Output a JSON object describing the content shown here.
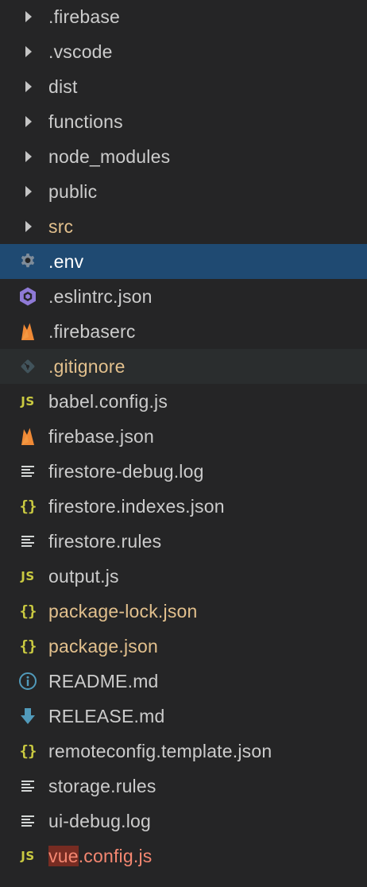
{
  "explorer": {
    "items": [
      {
        "name": ".firebase",
        "kind": "folder",
        "icon": "chevron-right-icon"
      },
      {
        "name": ".vscode",
        "kind": "folder",
        "icon": "chevron-right-icon"
      },
      {
        "name": "dist",
        "kind": "folder",
        "icon": "chevron-right-icon"
      },
      {
        "name": "functions",
        "kind": "folder",
        "icon": "chevron-right-icon"
      },
      {
        "name": "node_modules",
        "kind": "folder",
        "icon": "chevron-right-icon"
      },
      {
        "name": "public",
        "kind": "folder",
        "icon": "chevron-right-icon"
      },
      {
        "name": "src",
        "kind": "folder",
        "icon": "chevron-right-icon",
        "status": "modified"
      },
      {
        "name": ".env",
        "kind": "file",
        "icon": "gear-icon",
        "state": "selected"
      },
      {
        "name": ".eslintrc.json",
        "kind": "file",
        "icon": "eslint-icon"
      },
      {
        "name": ".firebaserc",
        "kind": "file",
        "icon": "firebase-icon"
      },
      {
        "name": ".gitignore",
        "kind": "file",
        "icon": "git-icon",
        "status": "modified",
        "state": "hover"
      },
      {
        "name": "babel.config.js",
        "kind": "file",
        "icon": "javascript-icon",
        "glyph": "JS"
      },
      {
        "name": "firebase.json",
        "kind": "file",
        "icon": "firebase-icon"
      },
      {
        "name": "firestore-debug.log",
        "kind": "file",
        "icon": "text-lines-icon"
      },
      {
        "name": "firestore.indexes.json",
        "kind": "file",
        "icon": "json-icon",
        "glyph": "{}"
      },
      {
        "name": "firestore.rules",
        "kind": "file",
        "icon": "text-lines-icon"
      },
      {
        "name": "output.js",
        "kind": "file",
        "icon": "javascript-icon",
        "glyph": "JS"
      },
      {
        "name": "package-lock.json",
        "kind": "file",
        "icon": "json-icon",
        "glyph": "{}",
        "status": "modified"
      },
      {
        "name": "package.json",
        "kind": "file",
        "icon": "json-icon",
        "glyph": "{}",
        "status": "modified"
      },
      {
        "name": "README.md",
        "kind": "file",
        "icon": "info-icon"
      },
      {
        "name": "RELEASE.md",
        "kind": "file",
        "icon": "markdown-download-icon"
      },
      {
        "name": "remoteconfig.template.json",
        "kind": "file",
        "icon": "json-icon",
        "glyph": "{}"
      },
      {
        "name": "storage.rules",
        "kind": "file",
        "icon": "text-lines-icon"
      },
      {
        "name": "ui-debug.log",
        "kind": "file",
        "icon": "text-lines-icon"
      },
      {
        "name": "vue.config.js",
        "kind": "file",
        "icon": "javascript-icon",
        "glyph": "JS",
        "status": "error",
        "highlight": "vue"
      }
    ]
  },
  "colors": {
    "background": "#252526",
    "selected": "#1f4a72",
    "hover": "#2a2d2e",
    "text": "#cccccc",
    "modified": "#e2c08d",
    "error": "#f48771",
    "js_yellow": "#cbcb41",
    "firebase_orange": "#f08a36",
    "eslint_purple": "#8f7ad6",
    "info_blue": "#519aba",
    "gear_gray": "#7e8c9a"
  }
}
